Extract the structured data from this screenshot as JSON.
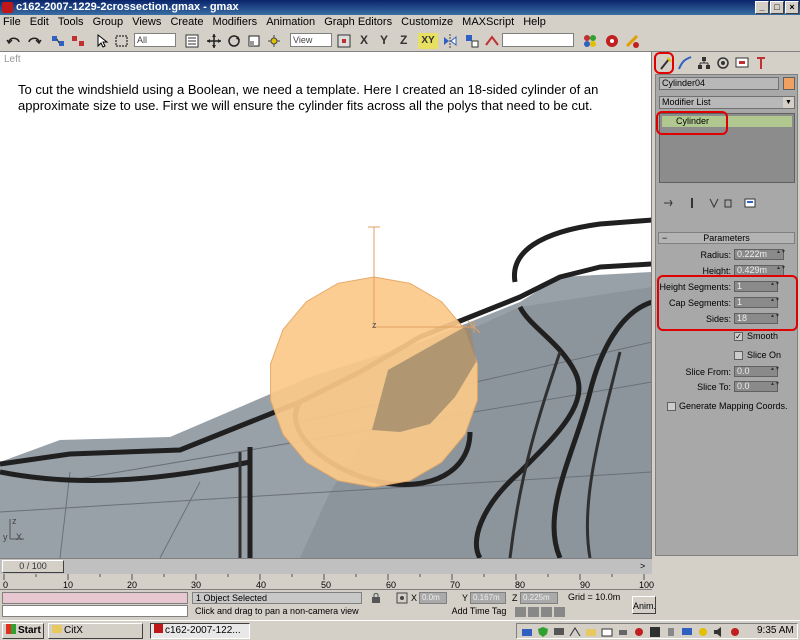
{
  "window": {
    "title": "c162-2007-1229-2crossection.gmax - gmax",
    "minimize": "_",
    "maximize": "□",
    "close": "×"
  },
  "menu": [
    "File",
    "Edit",
    "Tools",
    "Group",
    "Views",
    "Create",
    "Modifiers",
    "Animation",
    "Graph Editors",
    "Customize",
    "MAXScript",
    "Help"
  ],
  "toolbar": {
    "selection_filter": "All",
    "reference_coord": "View",
    "axis_xy": "XY",
    "named_selection": ""
  },
  "viewport": {
    "label": "Left",
    "instructions": "To cut the windshield using a Boolean, we need a template.  Here I created an 18-sided cylinder of an approximate size to use.  First we will ensure the cylinder fits across all the polys that need to be cut.",
    "axis_labels": {
      "z": "z",
      "y": "y",
      "x": "X",
      "gizmo_z": "z"
    }
  },
  "command_panel": {
    "object_name": "Cylinder04",
    "object_color": "#f0a060",
    "modifier_list_label": "Modifier List",
    "stack_item": "Cylinder",
    "rollout_title": "Parameters",
    "params": {
      "radius_label": "Radius:",
      "radius_value": "0.222m",
      "height_label": "Height:",
      "height_value": "0.429m",
      "height_segments_label": "Height Segments:",
      "height_segments_value": "1",
      "cap_segments_label": "Cap Segments:",
      "cap_segments_value": "1",
      "sides_label": "Sides:",
      "sides_value": "18",
      "smooth_label": "Smooth",
      "slice_on_label": "Slice On",
      "slice_from_label": "Slice From:",
      "slice_from_value": "0.0",
      "slice_to_label": "Slice To:",
      "slice_to_value": "0.0",
      "gen_mapping_label": "Generate Mapping Coords."
    }
  },
  "timeline": {
    "thumb": "0 / 100",
    "ticks": [
      "0",
      "10",
      "20",
      "30",
      "40",
      "50",
      "60",
      "70",
      "80",
      "90",
      "100"
    ]
  },
  "status": {
    "selected": "1 Object Selected",
    "prompt": "Click and drag to pan a non-camera view",
    "x_label": "X",
    "x_value": "0.0m",
    "y_label": "Y",
    "y_value": "0.167m",
    "z_label": "Z",
    "z_value": "0.225m",
    "grid": "Grid = 10.0m",
    "add_time_tag": "Add Time Tag",
    "anim_button": "Anim.",
    "frame_value": "0"
  },
  "taskbar": {
    "start": "Start",
    "item1": "CitX",
    "item2": "c162-2007-122...",
    "clock": "9:35 AM"
  }
}
